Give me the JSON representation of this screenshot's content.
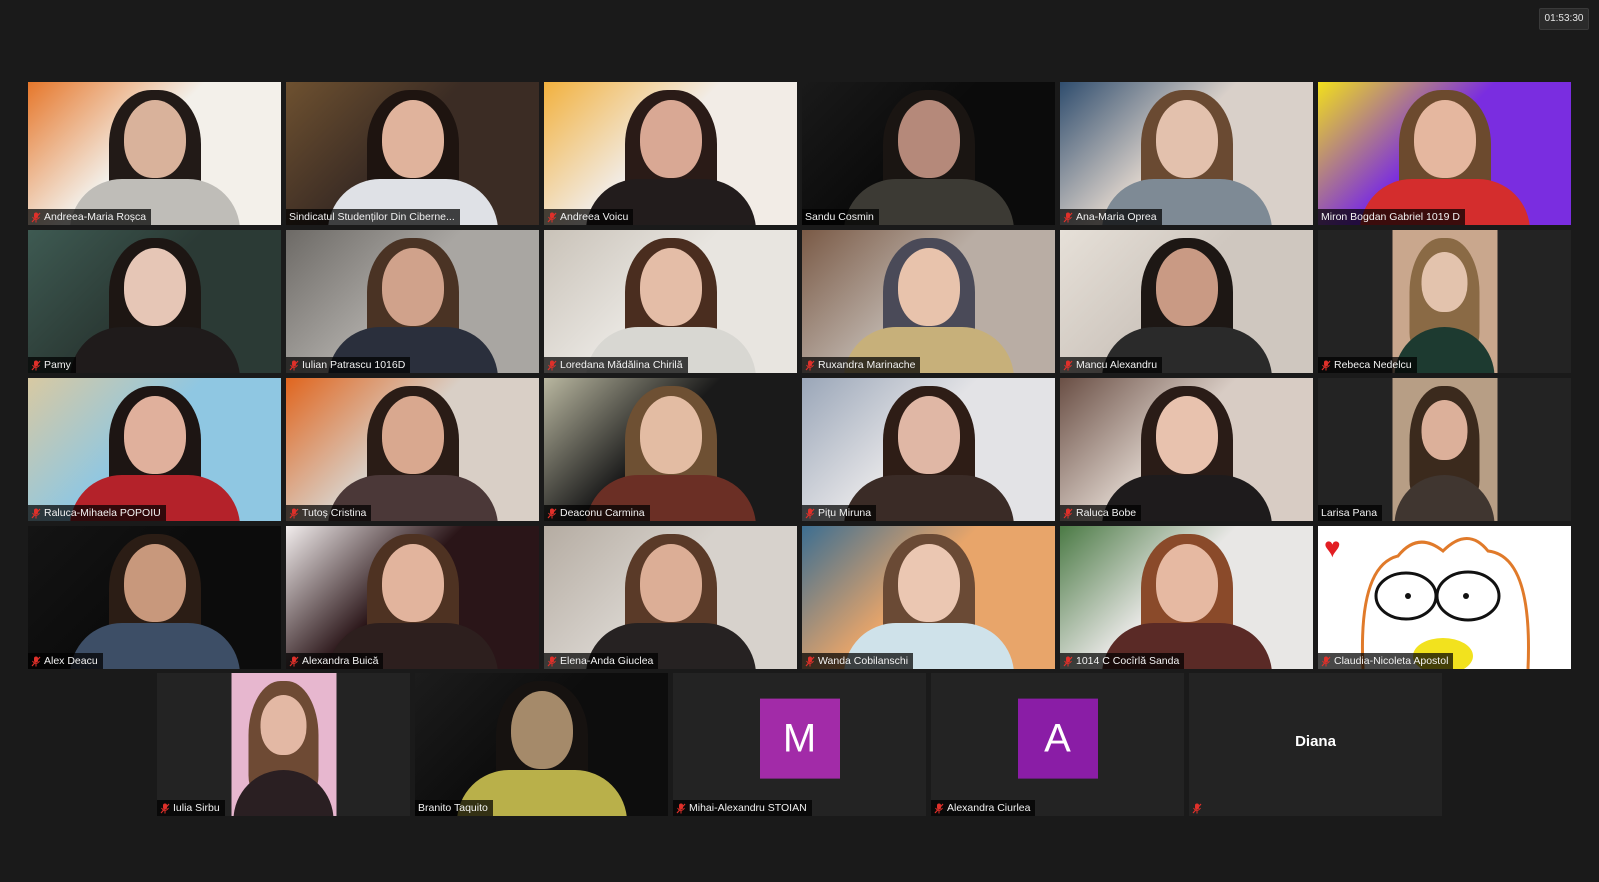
{
  "meeting": {
    "elapsed_time": "01:53:30"
  },
  "participants": [
    {
      "name": "Andreea-Maria Roșca",
      "muted": true,
      "speaking": false,
      "bg": "#f3f0ea",
      "accent": "#e6772b",
      "hair": "#221a17",
      "skin": "#d9b29b",
      "shirt": "#bfbdb8"
    },
    {
      "name": "Sindicatul Studenților Din Ciberne...",
      "muted": false,
      "speaking": true,
      "bg": "#3b2c24",
      "accent": "#6e5130",
      "hair": "#1e1410",
      "skin": "#e0b39c",
      "shirt": "#dfe1e6"
    },
    {
      "name": "Andreea Voicu",
      "muted": true,
      "speaking": false,
      "bg": "#f2ece6",
      "accent": "#f2b13e",
      "hair": "#2a1b17",
      "skin": "#d9a894",
      "shirt": "#221c1c"
    },
    {
      "name": "Sandu Cosmin",
      "muted": false,
      "speaking": false,
      "bg": "#0b0b0b",
      "accent": "#1a1a1a",
      "hair": "#1a1512",
      "skin": "#b5897a",
      "shirt": "#3c3a34"
    },
    {
      "name": "Ana-Maria Oprea",
      "muted": true,
      "speaking": false,
      "bg": "#d9d0c9",
      "accent": "#2f4d6e",
      "hair": "#6a4a32",
      "skin": "#e3c1ad",
      "shirt": "#7e8a95"
    },
    {
      "name": "Miron Bogdan Gabriel 1019 D",
      "muted": false,
      "speaking": false,
      "bg": "#7a2de0",
      "accent": "#f2e01b",
      "hair": "#6c4a2e",
      "skin": "#e5b79f",
      "shirt": "#d42d2d"
    },
    {
      "name": "Pamy",
      "muted": true,
      "speaking": false,
      "bg": "#2b3a35",
      "accent": "#3e5a52",
      "hair": "#1d1613",
      "skin": "#e6c6b6",
      "shirt": "#1f1b1b"
    },
    {
      "name": "Iulian Patrascu 1016D",
      "muted": true,
      "speaking": false,
      "bg": "#a9a6a2",
      "accent": "#6d6a66",
      "hair": "#4a3324",
      "skin": "#d0a28b",
      "shirt": "#2a2f3c"
    },
    {
      "name": "Loredana Mădălina Chirilă",
      "muted": true,
      "speaking": false,
      "bg": "#e8e5e0",
      "accent": "#c9c2b8",
      "hair": "#4a2d1f",
      "skin": "#e4bda7",
      "shirt": "#d8d7d2"
    },
    {
      "name": "Ruxandra Marinache",
      "muted": true,
      "speaking": false,
      "bg": "#b9ada4",
      "accent": "#7a5a46",
      "hair": "#4a4a58",
      "skin": "#e8c3ac",
      "shirt": "#c7b07a"
    },
    {
      "name": "Mancu Alexandru",
      "muted": true,
      "speaking": false,
      "bg": "#cfc7bf",
      "accent": "#e6e0d8",
      "hair": "#1d1714",
      "skin": "#c99a84",
      "shirt": "#2a2a2a"
    },
    {
      "name": "Rebeca Nedelcu",
      "muted": true,
      "speaking": false,
      "bg": "#232323",
      "accent": "#c9a78d",
      "hair": "#8a6a45",
      "skin": "#e3c3ad",
      "shirt": "#1d3a30",
      "narrow": true
    },
    {
      "name": "Raluca-Mihaela POPOIU",
      "muted": true,
      "speaking": false,
      "bg": "#8fc7e2",
      "accent": "#d8c9a2",
      "hair": "#1d1513",
      "skin": "#e0b09c",
      "shirt": "#b4222a"
    },
    {
      "name": "Tutoș Cristina",
      "muted": true,
      "speaking": false,
      "bg": "#d9cfc6",
      "accent": "#e0651e",
      "hair": "#2a1c16",
      "skin": "#d9a88f",
      "shirt": "#4b3838"
    },
    {
      "name": "Deaconu Carmina",
      "muted": true,
      "speaking": false,
      "bg": "#1a1a1a",
      "accent": "#b9b7a0",
      "hair": "#6e5033",
      "skin": "#e3bca3",
      "shirt": "#6b2f25"
    },
    {
      "name": "Pițu Miruna",
      "muted": true,
      "speaking": false,
      "bg": "#e3e3e6",
      "accent": "#9aa6b8",
      "hair": "#2e1d16",
      "skin": "#e0b7a5",
      "shirt": "#3a2b26"
    },
    {
      "name": "Raluca Bobe",
      "muted": true,
      "speaking": false,
      "bg": "#d8ccc4",
      "accent": "#6a4f45",
      "hair": "#2a1c17",
      "skin": "#e8c2ae",
      "shirt": "#1e1b1c"
    },
    {
      "name": "Larisa Pana",
      "muted": false,
      "speaking": false,
      "bg": "#232323",
      "accent": "#b79e85",
      "hair": "#3b2a1d",
      "skin": "#dcb09a",
      "shirt": "#403630",
      "narrow": true
    },
    {
      "name": "Alex Deacu",
      "muted": true,
      "speaking": false,
      "bg": "#0c0c0c",
      "accent": "#141414",
      "hair": "#2b1d15",
      "skin": "#c8987c",
      "shirt": "#3d4e66"
    },
    {
      "name": "Alexandra Buică",
      "muted": true,
      "speaking": false,
      "bg": "#2a1518",
      "accent": "#f2eded",
      "hair": "#4e3222",
      "skin": "#e2b49d",
      "shirt": "#2d1f1e"
    },
    {
      "name": "Elena-Anda Giuclea",
      "muted": true,
      "speaking": false,
      "bg": "#d7d2cc",
      "accent": "#b5aca2",
      "hair": "#5a3a28",
      "skin": "#dcae96",
      "shirt": "#262222"
    },
    {
      "name": "Wanda Cobilanschi",
      "muted": true,
      "speaking": false,
      "bg": "#e8a56a",
      "accent": "#3c6e91",
      "hair": "#6a4a35",
      "skin": "#ebc7b2",
      "shirt": "#cfe2ea"
    },
    {
      "name": "1014 C Cocîrlă Sanda",
      "muted": true,
      "speaking": false,
      "bg": "#e8e7e5",
      "accent": "#4b7a45",
      "hair": "#8a4a2a",
      "skin": "#e6b9a2",
      "shirt": "#5a2a26"
    },
    {
      "name": "Claudia-Nicoleta Apostol",
      "muted": true,
      "speaking": false,
      "bg": "#ffffff",
      "accent": "#e07a2a",
      "drawing": true
    },
    {
      "name": "Iulia Sirbu",
      "muted": true,
      "speaking": false,
      "bg": "#232323",
      "accent": "#e7b7cf",
      "hair": "#6e4a34",
      "skin": "#e3b8a4",
      "shirt": "#2a1f22",
      "narrow": true
    },
    {
      "name": "Branito Taquito",
      "muted": false,
      "speaking": false,
      "bg": "#0d0d0d",
      "accent": "#1c1c1c",
      "hair": "#161210",
      "skin": "#a58a6a",
      "shirt": "#b9b04a"
    },
    {
      "name": "Mihai-Alexandru STOIAN",
      "muted": true,
      "speaking": false,
      "avatar_letter": "M",
      "avatar_color": "#a22ba8"
    },
    {
      "name": "Alexandra Ciurlea",
      "muted": true,
      "speaking": false,
      "avatar_letter": "A",
      "avatar_color": "#8a1da6"
    },
    {
      "name": "",
      "display_name": "Diana",
      "muted": true,
      "speaking": false,
      "name_only": true
    }
  ]
}
